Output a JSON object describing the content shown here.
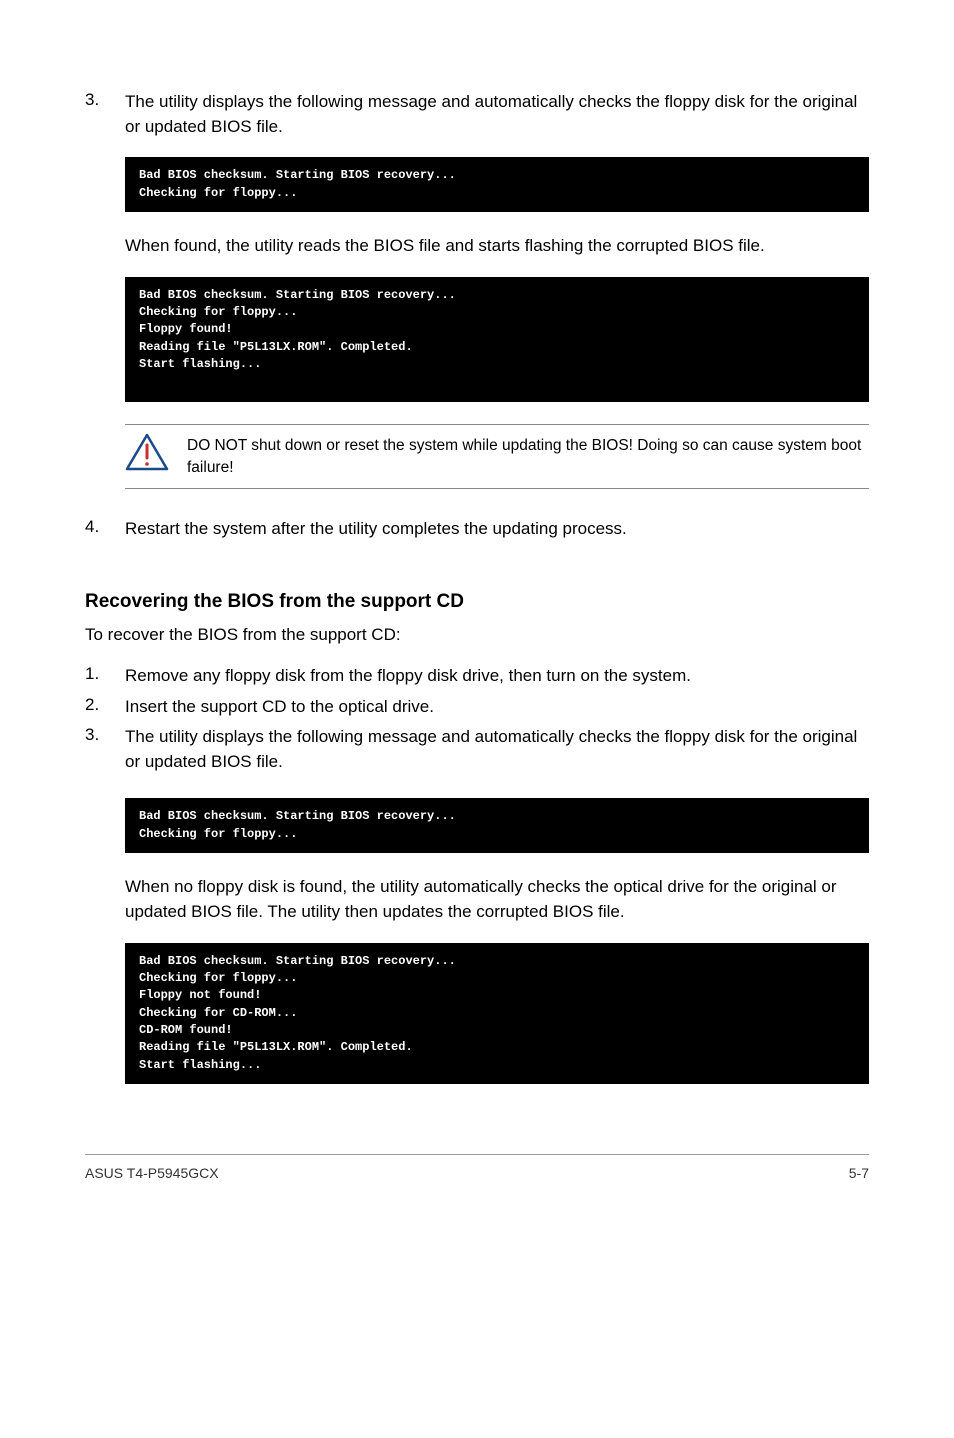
{
  "step3a": {
    "num": "3.",
    "text": "The utility displays the following message and automatically checks the floppy disk for the original or updated BIOS file."
  },
  "terminal1": "Bad BIOS checksum. Starting BIOS recovery...\nChecking for floppy...",
  "afterTerminal1": "When found, the utility reads the BIOS file and starts flashing the corrupted BIOS file.",
  "terminal2": "Bad BIOS checksum. Starting BIOS recovery...\nChecking for floppy...\nFloppy found!\nReading file \"P5L13LX.ROM\". Completed.\nStart flashing...",
  "callout1": "DO NOT shut down or reset the system while updating the BIOS! Doing so can cause system boot failure!",
  "step4": {
    "num": "4.",
    "text": "Restart the system after the utility completes the updating process."
  },
  "sectionHeading": "Recovering the BIOS from the support CD",
  "sectionIntro": "To recover the BIOS from the support CD:",
  "list2": {
    "item1": {
      "num": "1.",
      "text": "Remove any floppy disk from the floppy disk drive, then turn on the system."
    },
    "item2": {
      "num": "2.",
      "text": "Insert the support CD to the optical drive."
    },
    "item3": {
      "num": "3.",
      "text": "The utility displays the following message and automatically checks the floppy disk for the original or updated BIOS file."
    }
  },
  "terminal3": "Bad BIOS checksum. Starting BIOS recovery...\nChecking for floppy...",
  "afterTerminal3": "When no floppy disk is found, the utility automatically checks the optical drive for the original or updated BIOS file. The utility then updates the corrupted BIOS file.",
  "terminal4": "Bad BIOS checksum. Starting BIOS recovery...\nChecking for floppy...\nFloppy not found!\nChecking for CD-ROM...\nCD-ROM found!\nReading file \"P5L13LX.ROM\". Completed.\nStart flashing...",
  "footer": {
    "left": "ASUS T4-P5945GCX",
    "right": "5-7"
  }
}
